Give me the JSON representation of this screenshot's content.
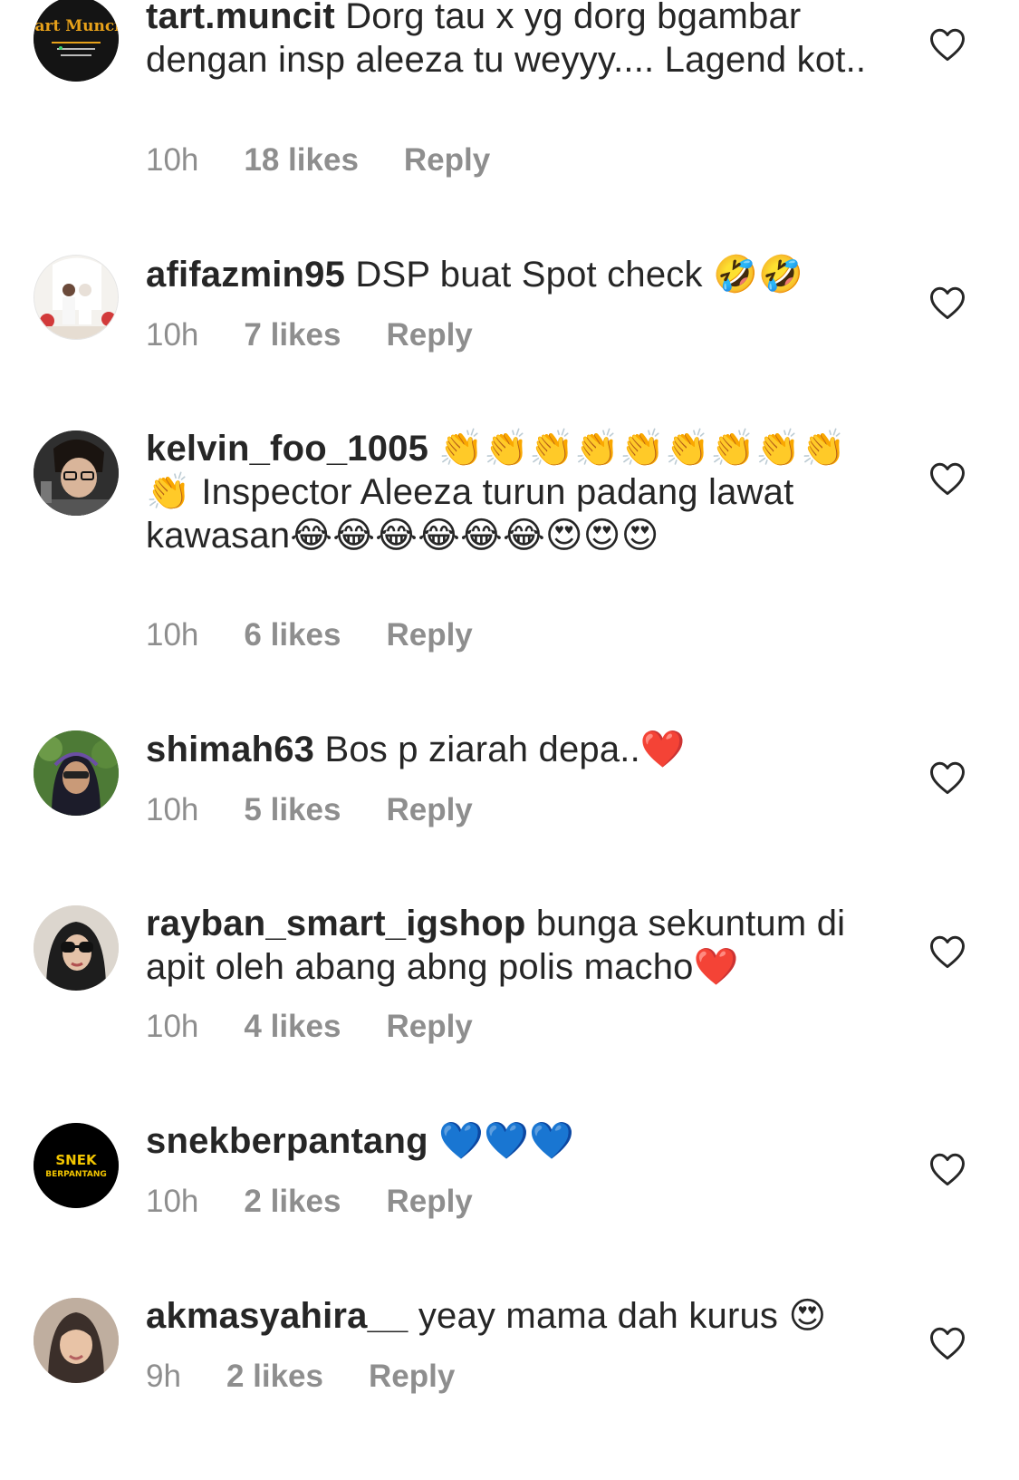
{
  "comments": [
    {
      "username": "tart.muncit",
      "text": " Dorg tau x yg dorg bgambar dengan insp aleeza tu weyyy.... Lagend kot..",
      "time": "10h",
      "likes": "18 likes",
      "reply": "Reply",
      "avatar_text": "Tart Muncit"
    },
    {
      "username": "afifazmin95",
      "text": " DSP buat Spot check 🤣🤣",
      "time": "10h",
      "likes": "7 likes",
      "reply": "Reply"
    },
    {
      "username": "kelvin_foo_1005",
      "text": " 👏👏👏👏👏👏👏👏👏👏 Inspector Aleeza turun padang lawat kawasan😂😂😂😂😂😂😍😍😍",
      "time": "10h",
      "likes": "6 likes",
      "reply": "Reply"
    },
    {
      "username": "shimah63",
      "text": " Bos p ziarah depa..❤️",
      "time": "10h",
      "likes": "5 likes",
      "reply": "Reply"
    },
    {
      "username": "rayban_smart_igshop",
      "text": " bunga sekuntum di apit oleh abang abng polis macho❤️",
      "time": "10h",
      "likes": "4 likes",
      "reply": "Reply"
    },
    {
      "username": "snekberpantang",
      "text": " 💙💙💙",
      "time": "10h",
      "likes": "2 likes",
      "reply": "Reply",
      "avatar_text_1": "SNEK",
      "avatar_text_2": "BERPANTANG"
    },
    {
      "username": "akmasyahira__",
      "text": " yeay mama dah kurus 😍",
      "time": "9h",
      "likes": "2 likes",
      "reply": "Reply"
    }
  ],
  "colors": {
    "text": "#262626",
    "meta": "#8e8e8e",
    "background": "#ffffff"
  }
}
